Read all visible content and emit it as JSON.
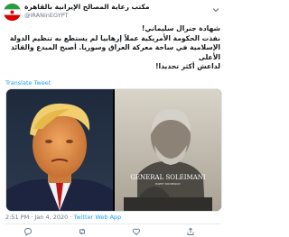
{
  "account": {
    "display_name": "مکتب رعاية المصالح الإيرانية بالقاهرة",
    "handle": "@IRANinEGYPT",
    "avatar_icon": "flag-avatar-icon"
  },
  "tweet": {
    "text_line1": "شهادة جنرال سليماني!",
    "text_line2": "نفذت الحكومة الأمريكية عملاً إرهابيا لم يستطع به تنظيم الدولة",
    "text_line3": "الإسلامية في ساحة معركة العراق وسوريا. أصبح المبدع والقائد الأعلى",
    "text_line4": "لداعش أكثر تحديدا!",
    "translate_label": "Translate Tweet"
  },
  "media": {
    "poster_title": "GENERAL SOLEIMANI",
    "poster_subtitle": "HAPPY DOOMSDAY"
  },
  "meta": {
    "time_date": "2:51 PM · Jan 4, 2020 · ",
    "source": "Twitter Web App"
  },
  "colors": {
    "link": "#1da1f2",
    "muted": "#657786"
  }
}
